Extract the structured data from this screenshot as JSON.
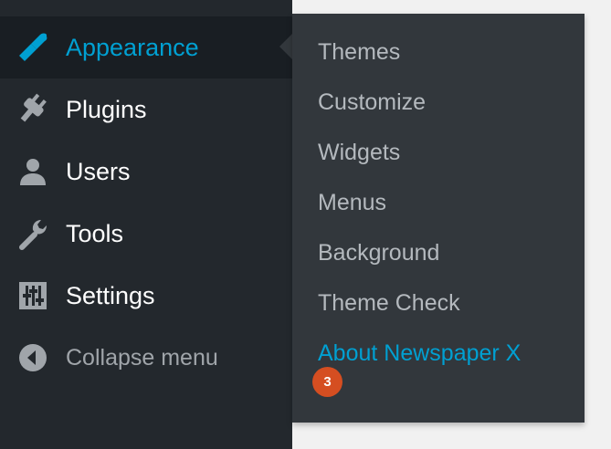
{
  "sidebar": {
    "items": [
      {
        "label": "Appearance",
        "icon": "paintbrush-icon",
        "active": true
      },
      {
        "label": "Plugins",
        "icon": "plugin-icon"
      },
      {
        "label": "Users",
        "icon": "user-icon"
      },
      {
        "label": "Tools",
        "icon": "wrench-icon"
      },
      {
        "label": "Settings",
        "icon": "sliders-icon"
      }
    ],
    "collapse": {
      "label": "Collapse menu",
      "icon": "collapse-arrow-icon"
    }
  },
  "submenu": {
    "items": [
      {
        "label": "Themes"
      },
      {
        "label": "Customize"
      },
      {
        "label": "Widgets"
      },
      {
        "label": "Menus"
      },
      {
        "label": "Background"
      },
      {
        "label": "Theme Check"
      },
      {
        "label": "About Newspaper X",
        "highlight": true
      }
    ],
    "badge": "3"
  },
  "colors": {
    "sidebar_bg": "#23282d",
    "active_bg": "#191e23",
    "submenu_bg": "#32373c",
    "accent": "#00a0d2",
    "badge": "#d54e21",
    "icon": "#a0a5aa"
  }
}
